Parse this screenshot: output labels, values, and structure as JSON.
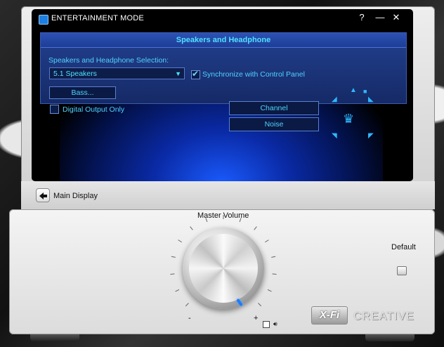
{
  "window": {
    "title": "ENTERTAINMENT MODE",
    "help": "?",
    "minimize": "—",
    "close": "✕"
  },
  "panel": {
    "header": "Speakers and Headphone",
    "selection_label": "Speakers and Headphone Selection:",
    "selection_value": "5.1 Speakers",
    "sync_label": "Synchronize with Control Panel",
    "sync_checked": true,
    "bass_button": "Bass...",
    "digital_output_label": "Digital Output Only",
    "digital_output_checked": false,
    "channel_button": "Channel",
    "noise_button": "Noise"
  },
  "nav": {
    "main_display": "Main Display"
  },
  "volume": {
    "label": "Master Volume",
    "minus": "-",
    "plus": "+"
  },
  "default_label": "Default",
  "branding": {
    "xfi": "X-Fi",
    "creative": "CREATIVE"
  },
  "colors": {
    "accent": "#4fe0ff",
    "panel": "#1d3d95",
    "knob_indicator": "#1d7bff"
  }
}
